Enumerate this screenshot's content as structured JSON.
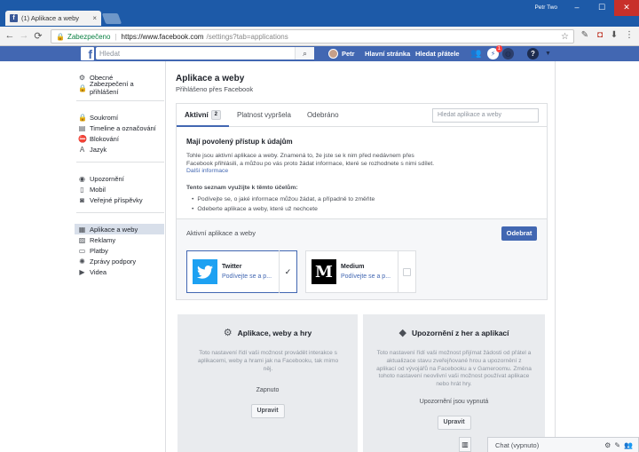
{
  "browser": {
    "tab_title": "(1) Aplikace a weby",
    "tab_close": "×",
    "window_user": "Petr Two",
    "win_min": "–",
    "win_max": "☐",
    "win_close": "✕",
    "back": "←",
    "forward": "→",
    "reload": "⟳",
    "secure_label": "Zabezpečeno",
    "url_host": "https://www.facebook.com",
    "url_path": "/settings?tab=applications",
    "star": "☆"
  },
  "fb": {
    "logo": "f",
    "search_placeholder": "Hledat",
    "search_icon": "⌕",
    "profile_name": "Petr",
    "home": "Hlavní stránka",
    "find_friends": "Hledat přátele",
    "notif_count": "1"
  },
  "sidebar": {
    "groups": [
      [
        {
          "icon": "⚙",
          "label": "Obecné"
        },
        {
          "icon": "🔒",
          "label": "Zabezpečení a přihlášení"
        }
      ],
      [
        {
          "icon": "🔒",
          "label": "Soukromí"
        },
        {
          "icon": "▤",
          "label": "Timeline a označování"
        },
        {
          "icon": "⛔",
          "label": "Blokování"
        },
        {
          "icon": "A",
          "label": "Jazyk"
        }
      ],
      [
        {
          "icon": "◉",
          "label": "Upozornění"
        },
        {
          "icon": "▯",
          "label": "Mobil"
        },
        {
          "icon": "◙",
          "label": "Veřejné příspěvky"
        }
      ],
      [
        {
          "icon": "▦",
          "label": "Aplikace a weby"
        },
        {
          "icon": "▨",
          "label": "Reklamy"
        },
        {
          "icon": "▭",
          "label": "Platby"
        },
        {
          "icon": "✺",
          "label": "Zprávy podpory"
        },
        {
          "icon": "▶",
          "label": "Videa"
        }
      ]
    ]
  },
  "main": {
    "title": "Aplikace a weby",
    "subtitle": "Přihlášeno přes Facebook",
    "tabs": {
      "active": "Aktivní",
      "active_count": "2",
      "expired": "Platnost vypršela",
      "removed": "Odebráno"
    },
    "app_search_placeholder": "Hledat aplikace a weby",
    "intro_heading": "Mají povolený přístup k údajům",
    "intro_text": "Tohle jsou aktivní aplikace a weby. Znamená to, že jste se k nim před nedávnem přes Facebook přihlásili, a můžou po vás proto žádat informace, které se rozhodnete s nimi sdílet.",
    "more_info": "Další informace",
    "list_heading": "Tento seznam využijte k těmto účelům:",
    "bullets": [
      "Podívejte se, o jaké informace můžou žádat, a případně to změňte",
      "Odeberte aplikace a weby, které už nechcete"
    ],
    "active_label": "Aktivní aplikace a weby",
    "remove_button": "Odebrat",
    "apps": [
      {
        "name": "Twitter",
        "link": "Podívejte se a p..."
      },
      {
        "name": "Medium",
        "link": "Podívejte se a p..."
      }
    ],
    "cards": [
      {
        "icon": "⚙",
        "title": "Aplikace, weby a hry",
        "desc": "Toto nastavení řídí vaši možnost provádět interakce s aplikacemi, weby a hrami jak na Facebooku, tak mimo něj.",
        "state": "Zapnuto",
        "button": "Upravit"
      },
      {
        "icon": "◆",
        "title": "Upozornění z her a aplikací",
        "desc": "Toto nastavení řídí vaši možnost přijímat žádosti od přátel a aktualizace stavu zveřejňované hrou a upozornění z aplikací od vývojářů na Facebooku a v Gameroomu. Změna tohoto nastavení neovlivní vaši možnost používat aplikace nebo hrát hry.",
        "state": "Upozornění jsou vypnutá",
        "button": "Upravit"
      }
    ]
  },
  "chat": {
    "label": "Chat (vypnuto)"
  }
}
